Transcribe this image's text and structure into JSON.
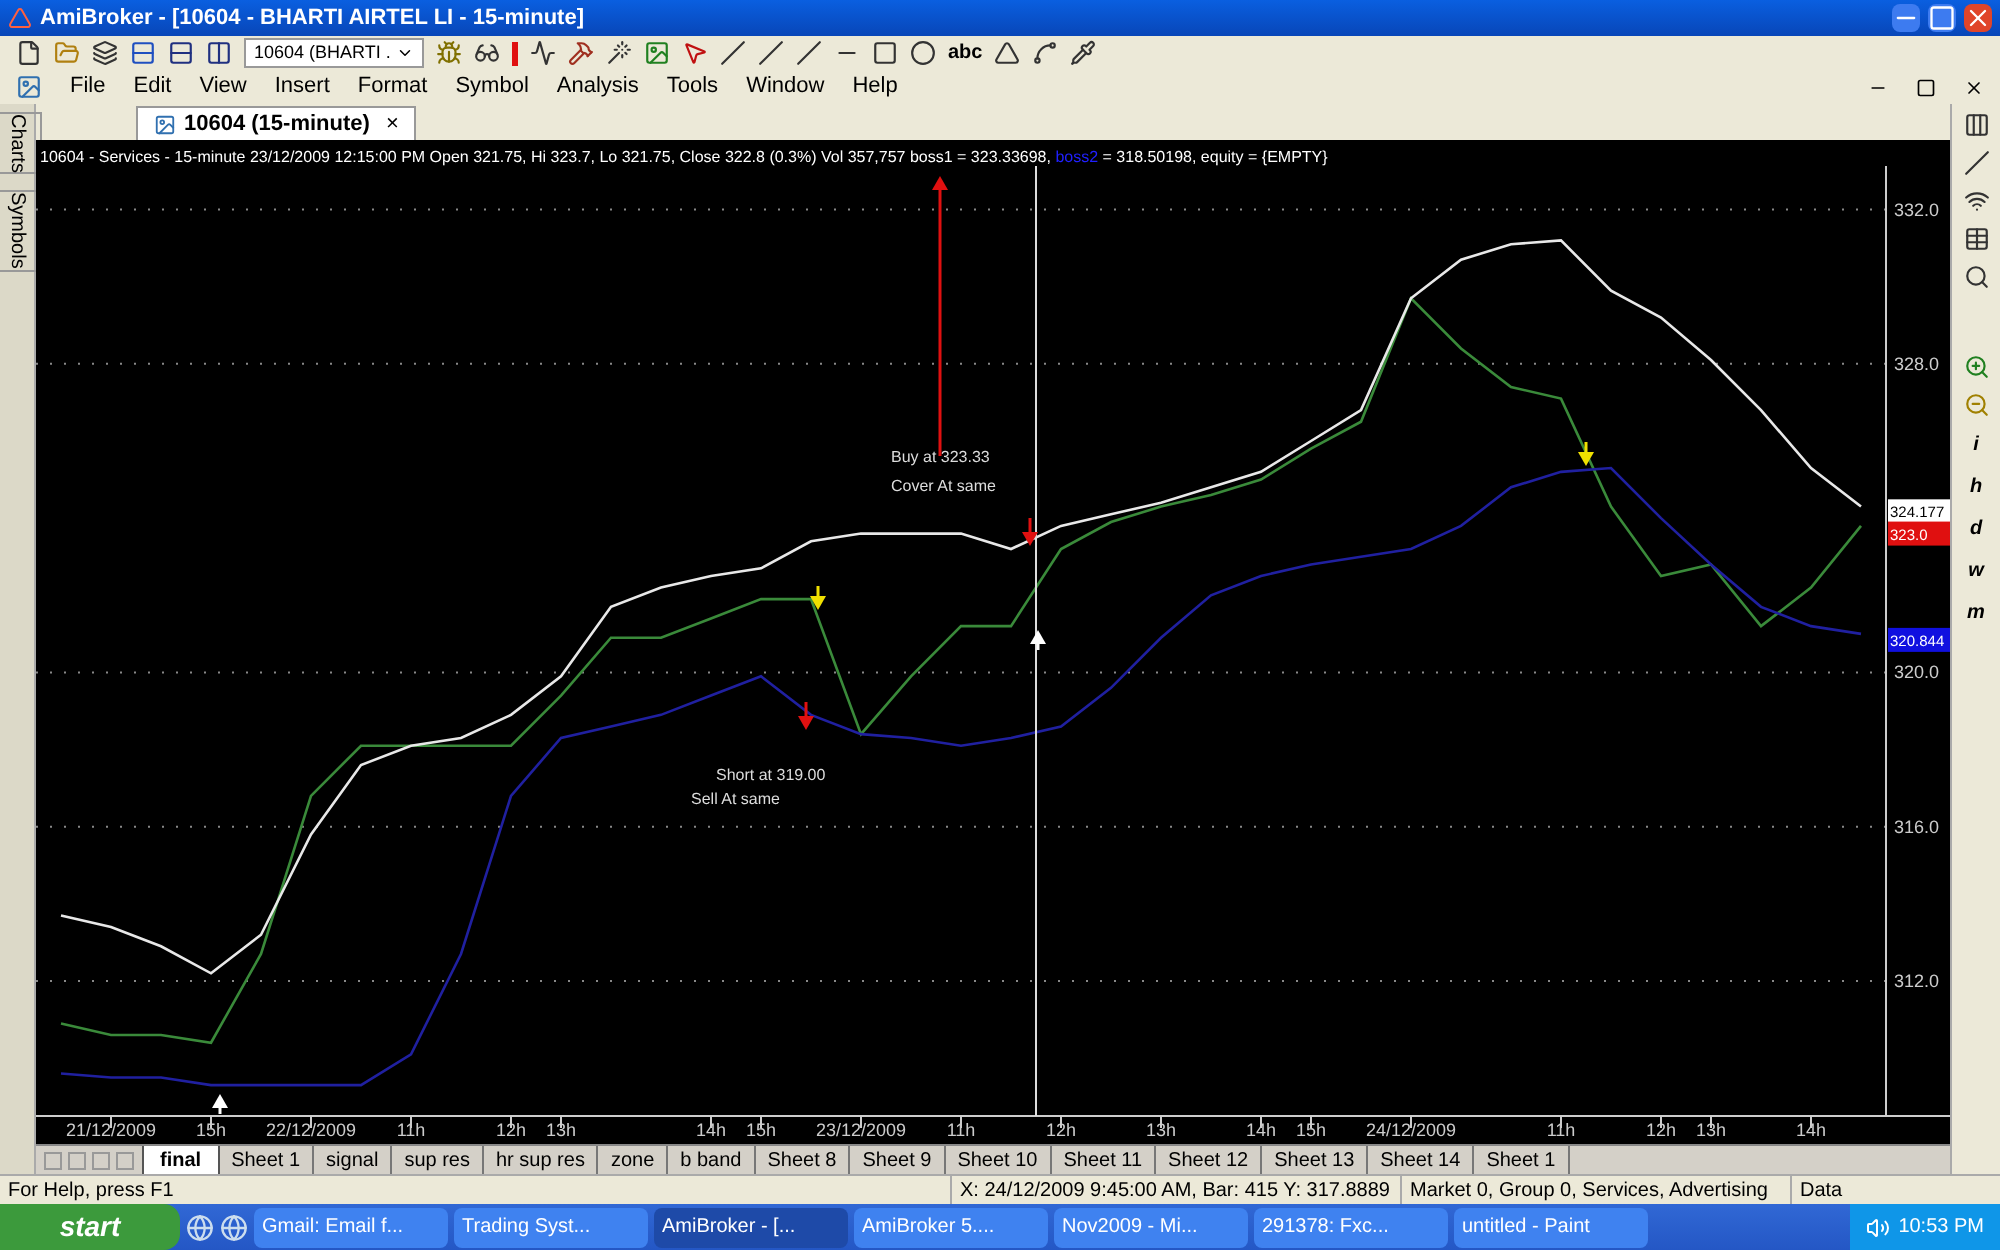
{
  "window": {
    "title": "AmiBroker - [10604 - BHARTI AIRTEL LI - 15-minute]"
  },
  "toolbar": {
    "symbol_combo": "10604 (BHARTI .",
    "text_tool": "abc"
  },
  "menu": [
    "File",
    "Edit",
    "View",
    "Insert",
    "Format",
    "Symbol",
    "Analysis",
    "Tools",
    "Window",
    "Help"
  ],
  "chart_tab": {
    "label": "10604 (15-minute)",
    "close": "×"
  },
  "side_tabs": [
    "Charts",
    "Symbols"
  ],
  "legend": [
    {
      "text": "10604 - Services - 15-minute 23/12/2009 12:15:00 PM Open 321.75, Hi 323.7, Lo 321.75, Close 322.8 (0.3%) Vol 357,757 boss1 = 323.33698, ",
      "color": "#ffffff"
    },
    {
      "text": "boss2",
      "color": "#2020ff"
    },
    {
      "text": " = 318.50198, equity = {EMPTY}",
      "color": "#ffffff"
    }
  ],
  "chart": {
    "chart_data": {
      "type": "line",
      "categories": [
        null,
        "21/12/2009",
        null,
        "15h",
        null,
        "22/12/2009",
        null,
        "11h",
        null,
        "12h",
        "13h",
        null,
        null,
        "14h",
        "15h",
        null,
        "23/12/2009",
        null,
        "11h",
        null,
        "12h",
        null,
        "13h",
        null,
        "14h",
        "15h",
        null,
        "24/12/2009",
        null,
        null,
        "11h",
        null,
        "12h",
        "13h",
        null,
        "14h",
        null
      ],
      "series": [
        {
          "color": "#3a8a3a",
          "values": [
            310.9,
            310.6,
            310.6,
            310.4,
            312.7,
            316.8,
            318.1,
            318.1,
            318.1,
            318.1,
            319.4,
            320.9,
            320.9,
            321.4,
            321.9,
            321.9,
            318.4,
            319.9,
            321.2,
            321.2,
            323.2,
            323.9,
            324.3,
            324.6,
            325.0,
            325.8,
            326.5,
            329.7,
            328.4,
            327.4,
            327.1,
            324.3,
            322.5,
            322.8,
            321.2,
            322.2,
            323.8
          ]
        },
        {
          "color": "#e8e8e8",
          "values": [
            313.7,
            313.4,
            312.9,
            312.2,
            313.2,
            315.8,
            317.6,
            318.1,
            318.3,
            318.9,
            319.9,
            321.7,
            322.2,
            322.5,
            322.7,
            323.4,
            323.6,
            323.6,
            323.6,
            323.2,
            323.8,
            324.1,
            324.4,
            324.8,
            325.2,
            326.0,
            326.8,
            329.7,
            330.7,
            331.1,
            331.2,
            329.9,
            329.2,
            328.1,
            326.8,
            325.3,
            324.3
          ]
        },
        {
          "color": "#2020a0",
          "values": [
            309.6,
            309.5,
            309.5,
            309.3,
            309.3,
            309.3,
            309.3,
            310.1,
            312.7,
            316.8,
            318.3,
            318.6,
            318.9,
            319.4,
            319.9,
            318.9,
            318.4,
            318.3,
            318.1,
            318.3,
            318.6,
            319.6,
            320.9,
            322.0,
            322.5,
            322.8,
            323.0,
            323.2,
            323.8,
            324.8,
            325.2,
            325.3,
            324.0,
            322.8,
            321.7,
            321.2,
            321.0
          ]
        }
      ],
      "ylim": [
        308.5,
        333.13
      ],
      "grid": true,
      "yticks": [
        {
          "value": 312,
          "label": "312.0"
        },
        {
          "value": 316,
          "label": "316.0"
        },
        {
          "value": 320,
          "label": "320.0"
        },
        {
          "value": 328,
          "label": "328.0"
        },
        {
          "value": 332,
          "label": "332.0"
        }
      ],
      "annotations": [
        "Buy at 323.33",
        "Cover At same",
        "Short at 319.00",
        "Sell At same"
      ]
    },
    "price_labels": [
      {
        "text": "324.177",
        "color": "#ffffff"
      },
      {
        "text": "323.0",
        "color": "#e01010"
      },
      {
        "text": "320.844",
        "color": "#1010e0"
      }
    ]
  },
  "right_toolbar_letters": [
    "i",
    "h",
    "d",
    "w",
    "m"
  ],
  "sheet_tabs": [
    {
      "label": "final",
      "selected": true
    },
    {
      "label": "Sheet 1",
      "selected": false
    },
    {
      "label": "signal",
      "selected": false
    },
    {
      "label": "sup res",
      "selected": false
    },
    {
      "label": "hr sup res",
      "selected": false
    },
    {
      "label": "zone",
      "selected": false
    },
    {
      "label": "b band",
      "selected": false
    },
    {
      "label": "Sheet 8",
      "selected": false
    },
    {
      "label": "Sheet 9",
      "selected": false
    },
    {
      "label": "Sheet 10",
      "selected": false
    },
    {
      "label": "Sheet 11",
      "selected": false
    },
    {
      "label": "Sheet 12",
      "selected": false
    },
    {
      "label": "Sheet 13",
      "selected": false
    },
    {
      "label": "Sheet 14",
      "selected": false
    },
    {
      "label": "Sheet 1",
      "selected": false
    }
  ],
  "status_bar": {
    "help": "For Help, press F1",
    "position": "X: 24/12/2009 9:45:00 AM, Bar: 415 Y: 317.8889",
    "market": "Market 0, Group 0, Services, Advertising",
    "data": "Data"
  },
  "taskbar": {
    "start": "start",
    "tasks": [
      {
        "label": "Gmail: Email f...",
        "selected": false
      },
      {
        "label": "Trading Syst...",
        "selected": false
      },
      {
        "label": "AmiBroker - [...",
        "selected": true
      },
      {
        "label": "AmiBroker 5....",
        "selected": false
      },
      {
        "label": "Nov2009 - Mi...",
        "selected": false
      },
      {
        "label": "291378: Fxc...",
        "selected": false
      },
      {
        "label": "untitled - Paint",
        "selected": false
      }
    ],
    "clock": "10:53 PM"
  }
}
